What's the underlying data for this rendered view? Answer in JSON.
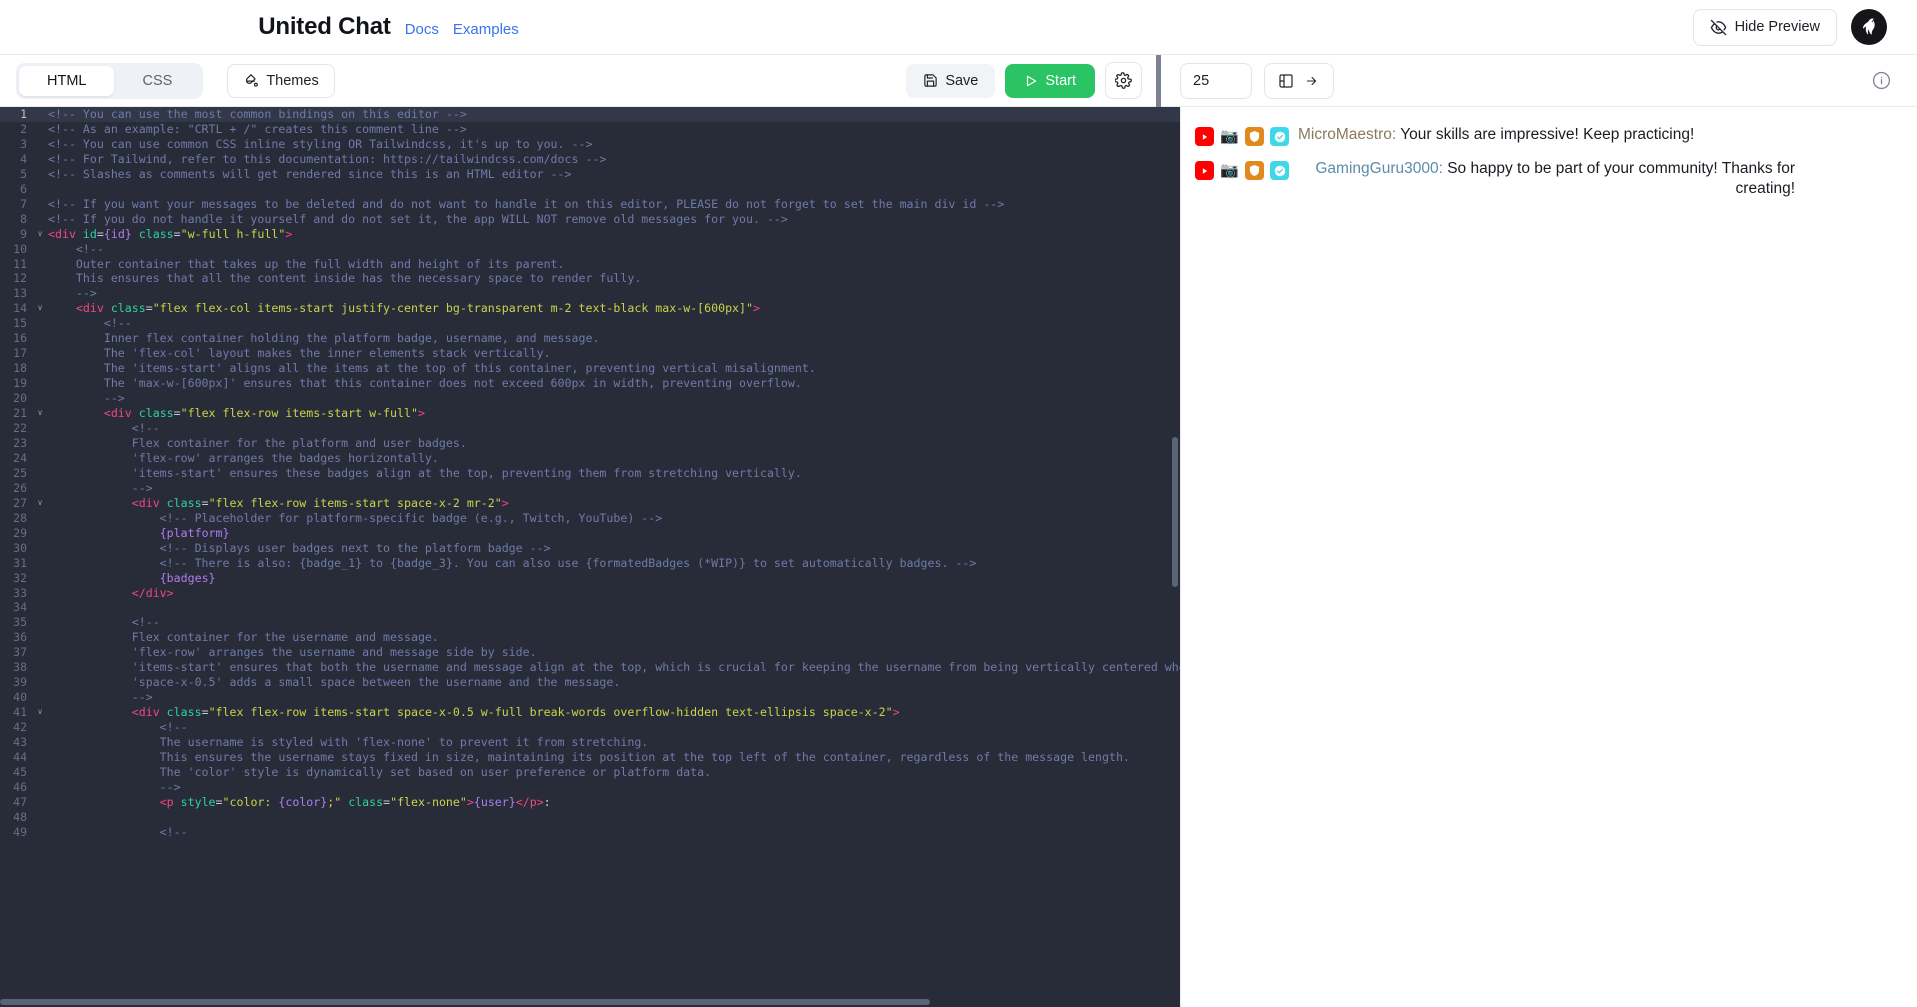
{
  "header": {
    "title": "United Chat",
    "nav": [
      {
        "label": "Docs",
        "name": "nav-link-docs"
      },
      {
        "label": "Examples",
        "name": "nav-link-examples"
      }
    ],
    "hide_preview_label": "Hide Preview",
    "avatar_name": "user-avatar"
  },
  "toolbar": {
    "tabs": [
      {
        "label": "HTML",
        "active": true
      },
      {
        "label": "CSS",
        "active": false
      }
    ],
    "themes_label": "Themes",
    "save_label": "Save",
    "start_label": "Start",
    "settings_icon": "gear-icon",
    "preview": {
      "count_value": "25",
      "layout_icon": "panel-layout-icon",
      "direction_icon": "arrow-right-icon",
      "info_icon": "info-circle-icon"
    }
  },
  "accent_colors": {
    "link": "#3b72f0",
    "start_button": "#2bc464",
    "editor_background": "#282c38",
    "comment": "#6f7aa8",
    "tag": "#f2477f",
    "attribute": "#2ed39a",
    "string": "#c9d44a",
    "variable": "#b07cf0"
  },
  "editor": {
    "active_line": 1,
    "lines": [
      {
        "n": 1,
        "fold": false,
        "highlight": true,
        "tokens": [
          {
            "t": "c",
            "v": "&lt;!-- You can use the most common bindings on this editor --&gt;"
          }
        ]
      },
      {
        "n": 2,
        "fold": false,
        "highlight": false,
        "tokens": [
          {
            "t": "c",
            "v": "&lt;!-- As an example: \"CRTL + /\" creates this comment line --&gt;"
          }
        ]
      },
      {
        "n": 3,
        "fold": false,
        "highlight": false,
        "tokens": [
          {
            "t": "c",
            "v": "&lt;!-- You can use common CSS inline styling OR Tailwindcss, it's up to you. --&gt;"
          }
        ]
      },
      {
        "n": 4,
        "fold": false,
        "highlight": false,
        "tokens": [
          {
            "t": "c",
            "v": "&lt;!-- For Tailwind, refer to this documentation: https://tailwindcss.com/docs --&gt;"
          }
        ]
      },
      {
        "n": 5,
        "fold": false,
        "highlight": false,
        "tokens": [
          {
            "t": "c",
            "v": "&lt;!-- Slashes as comments will get rendered since this is an HTML editor --&gt;"
          }
        ]
      },
      {
        "n": 6,
        "fold": false,
        "highlight": false,
        "tokens": []
      },
      {
        "n": 7,
        "fold": false,
        "highlight": false,
        "tokens": [
          {
            "t": "c",
            "v": "&lt;!-- If you want your messages to be deleted and do not want to handle it on this editor, PLEASE do not forget to set the main div id --&gt;"
          }
        ]
      },
      {
        "n": 8,
        "fold": false,
        "highlight": false,
        "tokens": [
          {
            "t": "c",
            "v": "&lt;!-- If you do not handle it yourself and do not set it, the app WILL NOT remove old messages for you. --&gt;"
          }
        ]
      },
      {
        "n": 9,
        "fold": true,
        "highlight": false,
        "tokens": [
          {
            "t": "tg",
            "v": "&lt;div"
          },
          {
            "t": "pl",
            "v": " "
          },
          {
            "t": "at",
            "v": "id"
          },
          {
            "t": "pl",
            "v": "="
          },
          {
            "t": "vr",
            "v": "{id}"
          },
          {
            "t": "pl",
            "v": " "
          },
          {
            "t": "at",
            "v": "class"
          },
          {
            "t": "pl",
            "v": "="
          },
          {
            "t": "st",
            "v": "\"w-full h-full\""
          },
          {
            "t": "tg",
            "v": "&gt;"
          }
        ]
      },
      {
        "n": 10,
        "fold": false,
        "highlight": false,
        "tokens": [
          {
            "t": "c",
            "v": "    &lt;!--"
          }
        ]
      },
      {
        "n": 11,
        "fold": false,
        "highlight": false,
        "tokens": [
          {
            "t": "c",
            "v": "    Outer container that takes up the full width and height of its parent."
          }
        ]
      },
      {
        "n": 12,
        "fold": false,
        "highlight": false,
        "tokens": [
          {
            "t": "c",
            "v": "    This ensures that all the content inside has the necessary space to render fully."
          }
        ]
      },
      {
        "n": 13,
        "fold": false,
        "highlight": false,
        "tokens": [
          {
            "t": "c",
            "v": "    --&gt;"
          }
        ]
      },
      {
        "n": 14,
        "fold": true,
        "highlight": false,
        "tokens": [
          {
            "t": "pl",
            "v": "    "
          },
          {
            "t": "tg",
            "v": "&lt;div"
          },
          {
            "t": "pl",
            "v": " "
          },
          {
            "t": "at",
            "v": "class"
          },
          {
            "t": "pl",
            "v": "="
          },
          {
            "t": "st",
            "v": "\"flex flex-col items-start justify-center bg-transparent m-2 text-black max-w-[600px]\""
          },
          {
            "t": "tg",
            "v": "&gt;"
          }
        ]
      },
      {
        "n": 15,
        "fold": false,
        "highlight": false,
        "tokens": [
          {
            "t": "c",
            "v": "        &lt;!--"
          }
        ]
      },
      {
        "n": 16,
        "fold": false,
        "highlight": false,
        "tokens": [
          {
            "t": "c",
            "v": "        Inner flex container holding the platform badge, username, and message."
          }
        ]
      },
      {
        "n": 17,
        "fold": false,
        "highlight": false,
        "tokens": [
          {
            "t": "c",
            "v": "        The 'flex-col' layout makes the inner elements stack vertically."
          }
        ]
      },
      {
        "n": 18,
        "fold": false,
        "highlight": false,
        "tokens": [
          {
            "t": "c",
            "v": "        The 'items-start' aligns all the items at the top of this container, preventing vertical misalignment."
          }
        ]
      },
      {
        "n": 19,
        "fold": false,
        "highlight": false,
        "tokens": [
          {
            "t": "c",
            "v": "        The 'max-w-[600px]' ensures that this container does not exceed 600px in width, preventing overflow."
          }
        ]
      },
      {
        "n": 20,
        "fold": false,
        "highlight": false,
        "tokens": [
          {
            "t": "c",
            "v": "        --&gt;"
          }
        ]
      },
      {
        "n": 21,
        "fold": true,
        "highlight": false,
        "tokens": [
          {
            "t": "pl",
            "v": "        "
          },
          {
            "t": "tg",
            "v": "&lt;div"
          },
          {
            "t": "pl",
            "v": " "
          },
          {
            "t": "at",
            "v": "class"
          },
          {
            "t": "pl",
            "v": "="
          },
          {
            "t": "st",
            "v": "\"flex flex-row items-start w-full\""
          },
          {
            "t": "tg",
            "v": "&gt;"
          }
        ]
      },
      {
        "n": 22,
        "fold": false,
        "highlight": false,
        "tokens": [
          {
            "t": "c",
            "v": "            &lt;!--"
          }
        ]
      },
      {
        "n": 23,
        "fold": false,
        "highlight": false,
        "tokens": [
          {
            "t": "c",
            "v": "            Flex container for the platform and user badges."
          }
        ]
      },
      {
        "n": 24,
        "fold": false,
        "highlight": false,
        "tokens": [
          {
            "t": "c",
            "v": "            'flex-row' arranges the badges horizontally."
          }
        ]
      },
      {
        "n": 25,
        "fold": false,
        "highlight": false,
        "tokens": [
          {
            "t": "c",
            "v": "            'items-start' ensures these badges align at the top, preventing them from stretching vertically."
          }
        ]
      },
      {
        "n": 26,
        "fold": false,
        "highlight": false,
        "tokens": [
          {
            "t": "c",
            "v": "            --&gt;"
          }
        ]
      },
      {
        "n": 27,
        "fold": true,
        "highlight": false,
        "tokens": [
          {
            "t": "pl",
            "v": "            "
          },
          {
            "t": "tg",
            "v": "&lt;div"
          },
          {
            "t": "pl",
            "v": " "
          },
          {
            "t": "at",
            "v": "class"
          },
          {
            "t": "pl",
            "v": "="
          },
          {
            "t": "st",
            "v": "\"flex flex-row items-start space-x-2 mr-2\""
          },
          {
            "t": "tg",
            "v": "&gt;"
          }
        ]
      },
      {
        "n": 28,
        "fold": false,
        "highlight": false,
        "tokens": [
          {
            "t": "c",
            "v": "                &lt;!-- Placeholder for platform-specific badge (e.g., Twitch, YouTube) --&gt;"
          }
        ]
      },
      {
        "n": 29,
        "fold": false,
        "highlight": false,
        "tokens": [
          {
            "t": "pl",
            "v": "                "
          },
          {
            "t": "vr",
            "v": "{platform}"
          }
        ]
      },
      {
        "n": 30,
        "fold": false,
        "highlight": false,
        "tokens": [
          {
            "t": "c",
            "v": "                &lt;!-- Displays user badges next to the platform badge --&gt;"
          }
        ]
      },
      {
        "n": 31,
        "fold": false,
        "highlight": false,
        "tokens": [
          {
            "t": "c",
            "v": "                &lt;!-- There is also: {badge_1} to {badge_3}. You can also use {formatedBadges (*WIP)} to set automatically badges. --&gt;"
          }
        ]
      },
      {
        "n": 32,
        "fold": false,
        "highlight": false,
        "tokens": [
          {
            "t": "pl",
            "v": "                "
          },
          {
            "t": "vr",
            "v": "{badges}"
          }
        ]
      },
      {
        "n": 33,
        "fold": false,
        "highlight": false,
        "tokens": [
          {
            "t": "pl",
            "v": "            "
          },
          {
            "t": "tg",
            "v": "&lt;/div&gt;"
          }
        ]
      },
      {
        "n": 34,
        "fold": false,
        "highlight": false,
        "tokens": []
      },
      {
        "n": 35,
        "fold": false,
        "highlight": false,
        "tokens": [
          {
            "t": "c",
            "v": "            &lt;!--"
          }
        ]
      },
      {
        "n": 36,
        "fold": false,
        "highlight": false,
        "tokens": [
          {
            "t": "c",
            "v": "            Flex container for the username and message."
          }
        ]
      },
      {
        "n": 37,
        "fold": false,
        "highlight": false,
        "tokens": [
          {
            "t": "c",
            "v": "            'flex-row' arranges the username and message side by side."
          }
        ]
      },
      {
        "n": 38,
        "fold": false,
        "highlight": false,
        "tokens": [
          {
            "t": "c",
            "v": "            'items-start' ensures that both the username and message align at the top, which is crucial for keeping the username from being vertically centered when the message is long."
          }
        ]
      },
      {
        "n": 39,
        "fold": false,
        "highlight": false,
        "tokens": [
          {
            "t": "c",
            "v": "            'space-x-0.5' adds a small space between the username and the message."
          }
        ]
      },
      {
        "n": 40,
        "fold": false,
        "highlight": false,
        "tokens": [
          {
            "t": "c",
            "v": "            --&gt;"
          }
        ]
      },
      {
        "n": 41,
        "fold": true,
        "highlight": false,
        "tokens": [
          {
            "t": "pl",
            "v": "            "
          },
          {
            "t": "tg",
            "v": "&lt;div"
          },
          {
            "t": "pl",
            "v": " "
          },
          {
            "t": "at",
            "v": "class"
          },
          {
            "t": "pl",
            "v": "="
          },
          {
            "t": "st",
            "v": "\"flex flex-row items-start space-x-0.5 w-full break-words overflow-hidden text-ellipsis space-x-2\""
          },
          {
            "t": "tg",
            "v": "&gt;"
          }
        ]
      },
      {
        "n": 42,
        "fold": false,
        "highlight": false,
        "tokens": [
          {
            "t": "c",
            "v": "                &lt;!--"
          }
        ]
      },
      {
        "n": 43,
        "fold": false,
        "highlight": false,
        "tokens": [
          {
            "t": "c",
            "v": "                The username is styled with 'flex-none' to prevent it from stretching."
          }
        ]
      },
      {
        "n": 44,
        "fold": false,
        "highlight": false,
        "tokens": [
          {
            "t": "c",
            "v": "                This ensures the username stays fixed in size, maintaining its position at the top left of the container, regardless of the message length."
          }
        ]
      },
      {
        "n": 45,
        "fold": false,
        "highlight": false,
        "tokens": [
          {
            "t": "c",
            "v": "                The 'color' style is dynamically set based on user preference or platform data."
          }
        ]
      },
      {
        "n": 46,
        "fold": false,
        "highlight": false,
        "tokens": [
          {
            "t": "c",
            "v": "                --&gt;"
          }
        ]
      },
      {
        "n": 47,
        "fold": false,
        "highlight": false,
        "tokens": [
          {
            "t": "pl",
            "v": "                "
          },
          {
            "t": "tg",
            "v": "&lt;p"
          },
          {
            "t": "pl",
            "v": " "
          },
          {
            "t": "at",
            "v": "style"
          },
          {
            "t": "pl",
            "v": "="
          },
          {
            "t": "st",
            "v": "\"color: "
          },
          {
            "t": "vr",
            "v": "{color}"
          },
          {
            "t": "st",
            "v": ";\""
          },
          {
            "t": "pl",
            "v": " "
          },
          {
            "t": "at",
            "v": "class"
          },
          {
            "t": "pl",
            "v": "="
          },
          {
            "t": "st",
            "v": "\"flex-none\""
          },
          {
            "t": "tg",
            "v": "&gt;"
          },
          {
            "t": "vr",
            "v": "{user}"
          },
          {
            "t": "tg",
            "v": "&lt;/p&gt;"
          },
          {
            "t": "pl",
            "v": ":"
          }
        ]
      },
      {
        "n": 48,
        "fold": false,
        "highlight": false,
        "tokens": []
      },
      {
        "n": 49,
        "fold": false,
        "highlight": false,
        "tokens": [
          {
            "t": "c",
            "v": "                &lt;!--"
          }
        ]
      }
    ]
  },
  "preview_chat": {
    "messages": [
      {
        "badges": [
          "youtube-icon",
          "camera-icon",
          "moderator-icon",
          "verified-icon"
        ],
        "username": "MicroMaestro",
        "username_color": "#8a7a5c",
        "separator": ":",
        "text": "Your skills are impressive! Keep practicing!"
      },
      {
        "badges": [
          "youtube-icon",
          "camera-icon",
          "moderator-icon",
          "verified-icon"
        ],
        "username": "GamingGuru3000",
        "username_color": "#5b8ca8",
        "separator": ":",
        "text": "So happy to be part of your community! Thanks for creating!"
      }
    ]
  }
}
